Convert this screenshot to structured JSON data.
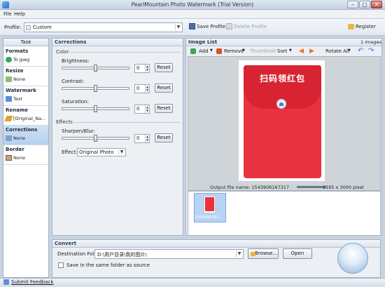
{
  "window": {
    "title": "PearlMountain Photo Watermark (Trial Version)"
  },
  "menu": {
    "file": "File",
    "help": "Help"
  },
  "profile": {
    "label": "Profile:",
    "value": "Custom",
    "save": "Save Profile",
    "delete": "Delete Profile",
    "register": "Register"
  },
  "tasks": {
    "header": "Task",
    "items": [
      {
        "title": "Formats",
        "value": "To Jpeg"
      },
      {
        "title": "Resize",
        "value": "None"
      },
      {
        "title": "Watermark",
        "value": "Text"
      },
      {
        "title": "Rename",
        "value": "[Original_Na..."
      },
      {
        "title": "Corrections",
        "value": "None"
      },
      {
        "title": "Border",
        "value": "None"
      }
    ]
  },
  "corrections": {
    "header": "Corrections",
    "color_section": "Color",
    "effects_section": "Effects",
    "brightness": {
      "label": "Brightness:",
      "value": "0",
      "level": 0.5,
      "reset": "Reset"
    },
    "contrast": {
      "label": "Contrast:",
      "value": "0",
      "level": 0.5,
      "reset": "Reset"
    },
    "saturation": {
      "label": "Saturation:",
      "value": "0",
      "level": 0.5,
      "reset": "Reset"
    },
    "sharpen": {
      "label": "Sharpen/Blur:",
      "value": "0",
      "level": 0.5,
      "reset": "Reset"
    },
    "effect": {
      "label": "Effect:",
      "value": "Original Photo"
    }
  },
  "image_list": {
    "header": "Image List",
    "count": "1 images",
    "add": "Add",
    "remove": "Remove",
    "thumbnail": "Thumbnail",
    "sort": "Sort",
    "rotate_all": "Rotate All",
    "image_text": "扫码领红包",
    "output_name_label": "Output file name: 1543906167317",
    "output_size": "2165 x 3000 pixel",
    "thumb_caption": "1543906167..."
  },
  "convert": {
    "header": "Convert",
    "dest_label": "Destination Folder:",
    "dest_value": "D:\\用户目录\\我的图片\\",
    "browse": "Browse...",
    "open": "Open",
    "same_folder": "Save in the same folder as source"
  },
  "status": {
    "feedback": "Submit Feedback"
  },
  "colors": {
    "accent": "#2b6fc5",
    "envelope": "#e8323f"
  }
}
